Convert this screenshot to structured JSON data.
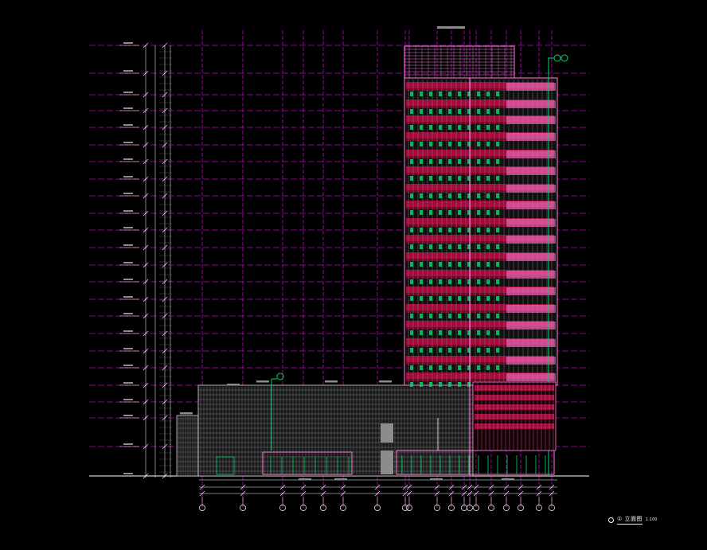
{
  "drawing": {
    "title_text": "① 立面图",
    "title_scale": "1:100",
    "colors": {
      "background": "#000000",
      "level_line": "#c000c0",
      "grid_line": "#ff00ff",
      "facade_red": "#a50a3c",
      "facade_red_dark": "#6e0626",
      "mullion": "#d4d4d4",
      "pink": "#ff7bd9",
      "green": "#00d86b",
      "grey_panel": "#8c8c8c",
      "white": "#ffffff"
    },
    "level_count": 20,
    "axis_count": 21
  }
}
